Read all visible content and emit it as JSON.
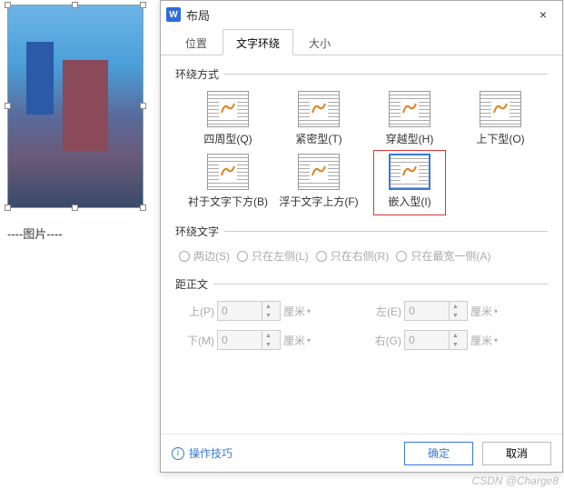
{
  "image": {
    "caption": "----图片----"
  },
  "dialog": {
    "title": "布局",
    "close": "×",
    "tabs": [
      "位置",
      "文字环绕",
      "大小"
    ],
    "active_tab": 1
  },
  "group_wrap": {
    "title": "环绕方式",
    "items": [
      {
        "label": "四周型(Q)"
      },
      {
        "label": "紧密型(T)"
      },
      {
        "label": "穿越型(H)"
      },
      {
        "label": "上下型(O)"
      },
      {
        "label": "衬于文字下方(B)"
      },
      {
        "label": "浮于文字上方(F)"
      },
      {
        "label": "嵌入型(I)"
      }
    ],
    "selected": 6
  },
  "group_text": {
    "title": "环绕文字",
    "radios": [
      "两边(S)",
      "只在左侧(L)",
      "只在右侧(R)",
      "只在最宽一侧(A)"
    ]
  },
  "group_dist": {
    "title": "距正文",
    "top": {
      "label": "上(P)",
      "value": "0",
      "unit": "厘米"
    },
    "bottom": {
      "label": "下(M)",
      "value": "0",
      "unit": "厘米"
    },
    "left": {
      "label": "左(E)",
      "value": "0",
      "unit": "厘米"
    },
    "right": {
      "label": "右(G)",
      "value": "0",
      "unit": "厘米"
    }
  },
  "footer": {
    "tip": "操作技巧",
    "ok": "确定",
    "cancel": "取消"
  },
  "watermark": "CSDN @Charge8"
}
